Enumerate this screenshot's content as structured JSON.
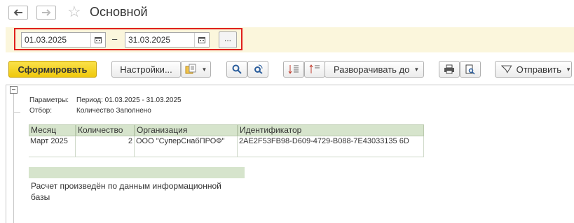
{
  "window": {
    "title": "Основной"
  },
  "period": {
    "from": "01.03.2025",
    "separator": "–",
    "to": "31.03.2025",
    "more_label": "..."
  },
  "toolbar": {
    "generate_label": "Сформировать",
    "settings_label": "Настройки...",
    "expand_label": "Разворачивать до",
    "send_label": "Отправить"
  },
  "report": {
    "params_label": "Параметры:",
    "params_value": "Период: 01.03.2025 - 31.03.2025",
    "filter_label": "Отбор:",
    "filter_value": "Количество Заполнено",
    "columns": [
      "Месяц",
      "Количество",
      "Организация",
      "Идентификатор"
    ],
    "row": {
      "month": "Март 2025",
      "quantity": "2",
      "organization": "ООО \"СуперСнабПРОФ\"",
      "identifier": "2AE2F53FB98-D609-4729-B088-7E43033135 6D"
    },
    "footer_note": "Расчет произведён по данным информационной базы"
  }
}
